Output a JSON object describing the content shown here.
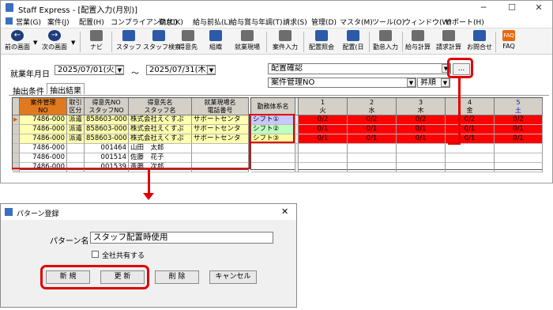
{
  "window": {
    "title": "Staff Express - [配置入力(月別)]"
  },
  "menubar": [
    "営業(G)",
    "案件(J)",
    "配置(H)",
    "コンプライアンス(C)",
    "勤怠(K)",
    "給与前払(L)",
    "給与賞与年調(T)",
    "請求(S)",
    "管理(D)",
    "マスタ(M)",
    "ツール(O)",
    "ウィンドウ(W)",
    "サポート(H)"
  ],
  "toolbar": {
    "buttons": [
      "前の画面",
      "次の画面",
      "ナビ",
      "スタッフ",
      "スタッフ検索",
      "得意先",
      "組織",
      "就業現場",
      "案件入力",
      "配置照会",
      "配置(日",
      "勤怠入力",
      "給与計算",
      "請求計算",
      "お問合せ",
      "FAQ"
    ],
    "faq_icon": "FAQ"
  },
  "form": {
    "period_label": "就業年月日",
    "date_from": "2025/07/01(火)",
    "tilde": "～",
    "date_to": "2025/07/31(木)",
    "pattern_value": "配置確認",
    "sort_field": "案件管理NO",
    "sort_order": "昇順",
    "ellipsis": "..."
  },
  "tabs": [
    "抽出条件",
    "抽出結果"
  ],
  "grid": {
    "headers_left": [
      [
        "案件管理",
        "NO"
      ],
      [
        "取引",
        "区分"
      ],
      [
        "得意先NO",
        "スタッフNO"
      ],
      [
        "得意先名",
        "スタッフ名"
      ],
      [
        "就業現場名",
        "電話番号"
      ]
    ],
    "header_shift": "勤務体系名",
    "day_headers": [
      [
        "1",
        "火"
      ],
      [
        "2",
        "水"
      ],
      [
        "3",
        "木"
      ],
      [
        "4",
        "金"
      ],
      [
        "5",
        "土"
      ]
    ],
    "rows": [
      {
        "no": "7486-000",
        "kbn": "派遣",
        "code": "858603-000",
        "name": "株式会社えくすぷ",
        "site": "サポートセンタ",
        "shift": "シフト①",
        "days": [
          "0/2",
          "0/2",
          "0/2",
          "0/2",
          "0/2"
        ]
      },
      {
        "no": "7486-000",
        "kbn": "派遣",
        "code": "858603-000",
        "name": "株式会社えくすぷ",
        "site": "サポートセンタ",
        "shift": "シフト②",
        "days": [
          "0/1",
          "0/1",
          "0/1",
          "0/1",
          "0/1"
        ]
      },
      {
        "no": "7486-000",
        "kbn": "派遣",
        "code": "858603-000",
        "name": "株式会社えくすぷ",
        "site": "サポートセンタ",
        "shift": "シフト③",
        "days": [
          "0/1",
          "0/1",
          "0/1",
          "0/1",
          "0/1"
        ]
      },
      {
        "no": "7486-000",
        "kbn": "",
        "code": "001464",
        "name": "山田　太郎",
        "site": "",
        "shift": "",
        "days": [
          "",
          "",
          "",
          "",
          ""
        ]
      },
      {
        "no": "7486-000",
        "kbn": "",
        "code": "001514",
        "name": "佐藤　花子",
        "site": "",
        "shift": "",
        "days": [
          "",
          "",
          "",
          "",
          ""
        ]
      },
      {
        "no": "7486-000",
        "kbn": "",
        "code": "001539",
        "name": "斎藤　次郎",
        "site": "",
        "shift": "",
        "days": [
          "",
          "",
          "",
          "",
          ""
        ]
      }
    ]
  },
  "dialog": {
    "title": "パターン登録",
    "name_label": "パターン名",
    "name_value": "スタッフ配置時使用",
    "share_label": "全社共有する",
    "buttons": {
      "new": "新 規",
      "update": "更 新",
      "delete": "削 除",
      "cancel": "キャンセル"
    }
  },
  "colors": {
    "accent_red": "#e00000",
    "cell_red": "#ff0000",
    "shift1": "#c8c8ff",
    "shift2": "#c0ffc0",
    "shift3": "#ffffa0"
  }
}
